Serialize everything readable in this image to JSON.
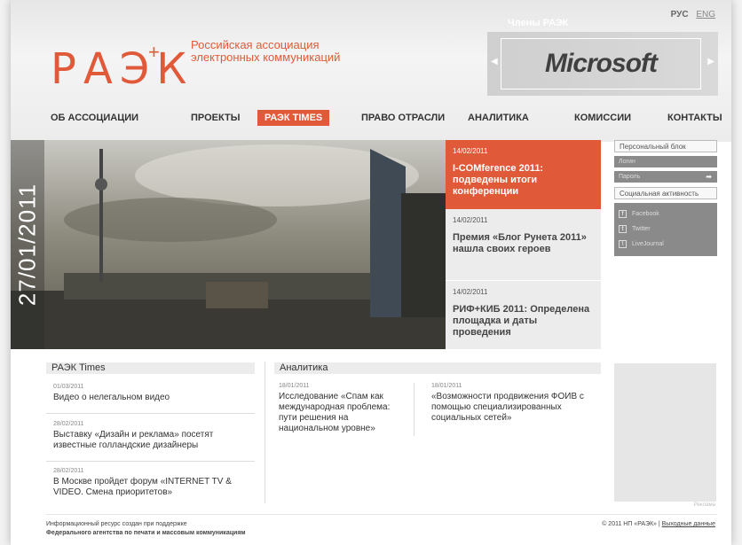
{
  "header": {
    "logo_text": "РАЭК",
    "logo_plus": "+",
    "tagline_line1": "Российская ассоциация",
    "tagline_line2": "электронных коммуникаций",
    "lang_ru": "РУС",
    "lang_en": "ENG",
    "members_title": "Члены РАЭК",
    "member_logo": "Microsoft"
  },
  "nav": {
    "items": [
      "ОБ АССОЦИАЦИИ",
      "ПРОЕКТЫ",
      "РАЭК TIMES",
      "ПРАВО ОТРАСЛИ",
      "АНАЛИТИКА",
      "КОМИССИИ",
      "КОНТАКТЫ"
    ],
    "active": "РАЭК TIMES"
  },
  "hero": {
    "date": "27/01/2011",
    "news": [
      {
        "date": "14/02/2011",
        "title": "I-COMference 2011: подведены итоги конференции"
      },
      {
        "date": "14/02/2011",
        "title": "Премия «Блог Рунета 2011» нашла своих героев"
      },
      {
        "date": "14/02/2011",
        "title": "РИФ+КИБ 2011: Определена площадка и даты проведения"
      }
    ]
  },
  "personal": {
    "title": "Персональный блок",
    "login_placeholder": "Логин",
    "password_placeholder": "Пароль",
    "social_title": "Социальная активность",
    "social": [
      {
        "icon": "facebook-icon",
        "glyph": "f",
        "label": "Facebook"
      },
      {
        "icon": "twitter-icon",
        "glyph": "t",
        "label": "Twitter"
      },
      {
        "icon": "livejournal-icon",
        "glyph": "\\",
        "label": "LiveJournal"
      }
    ]
  },
  "times": {
    "title": "РАЭК Times",
    "items": [
      {
        "date": "01/03/2011",
        "title": "Видео о нелегальном видео"
      },
      {
        "date": "28/02/2011",
        "title": "Выставку «Дизайн и реклама» посетят известные голландские дизайнеры"
      },
      {
        "date": "28/02/2011",
        "title": "В Москве пройдет форум «INTERNET TV & VIDEO. Смена приоритетов»"
      }
    ]
  },
  "analytics": {
    "title": "Аналитика",
    "items": [
      {
        "date": "18/01/2011",
        "title": "Исследование «Спам как международная проблема: пути решения на национальном уровне»"
      },
      {
        "date": "18/01/2011",
        "title": "«Возможности продвижения ФОИВ с помощью специализированных социальных сетей»"
      }
    ]
  },
  "ad_label": "Реклама",
  "footer": {
    "left_line1": "Информационный ресурс создан при поддержке",
    "left_line2": "Федерального агентства по печати и массовым коммуникациям",
    "copyright": "© 2011 НП «РАЭК» |",
    "imprint": "Выходные данные"
  },
  "colors": {
    "accent": "#e05a3a",
    "gray": "#8a8a8a"
  }
}
